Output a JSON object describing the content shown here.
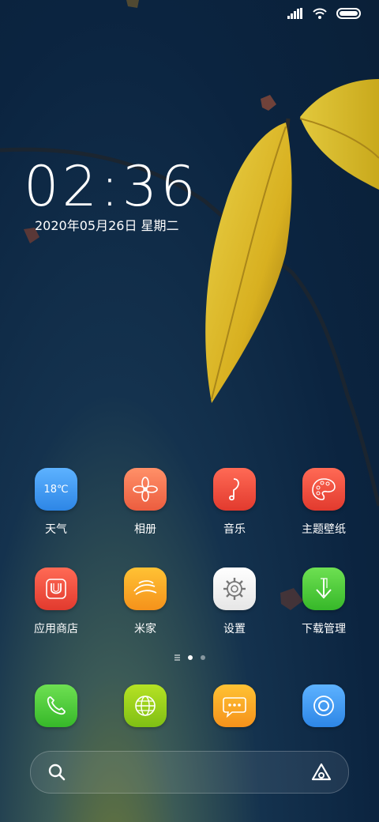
{
  "status_bar": {
    "signal_icon": "signal-icon",
    "wifi_icon": "wifi-icon",
    "battery_icon": "battery-icon"
  },
  "clock": {
    "time": "02:36",
    "date": "2020年05月26日 星期二"
  },
  "apps": [
    {
      "label": "天气",
      "icon": "weather-icon",
      "badge": "18℃",
      "color": "#3d9df0"
    },
    {
      "label": "相册",
      "icon": "gallery-icon",
      "color": "#f0744e"
    },
    {
      "label": "音乐",
      "icon": "music-icon",
      "color": "#ef4b3e"
    },
    {
      "label": "主题壁纸",
      "icon": "palette-icon",
      "color": "#ef4b3e"
    },
    {
      "label": "应用商店",
      "icon": "store-icon",
      "color": "#ef4b3e"
    },
    {
      "label": "米家",
      "icon": "mijia-icon",
      "color": "#f8a51d"
    },
    {
      "label": "设置",
      "icon": "settings-icon",
      "color": "#f5f5f5"
    },
    {
      "label": "下载管理",
      "icon": "download-icon",
      "color": "#4fd03a"
    }
  ],
  "dock": [
    {
      "icon": "phone-icon",
      "color": "#4fd03a"
    },
    {
      "icon": "browser-icon",
      "color": "#9ed21a"
    },
    {
      "icon": "messages-icon",
      "color": "#f8a51d"
    },
    {
      "icon": "camera-icon",
      "color": "#3d9df0"
    }
  ],
  "page_indicator": {
    "pages": 2,
    "active": 1
  },
  "search": {
    "search_icon": "search-icon",
    "assistant_icon": "assistant-icon"
  }
}
